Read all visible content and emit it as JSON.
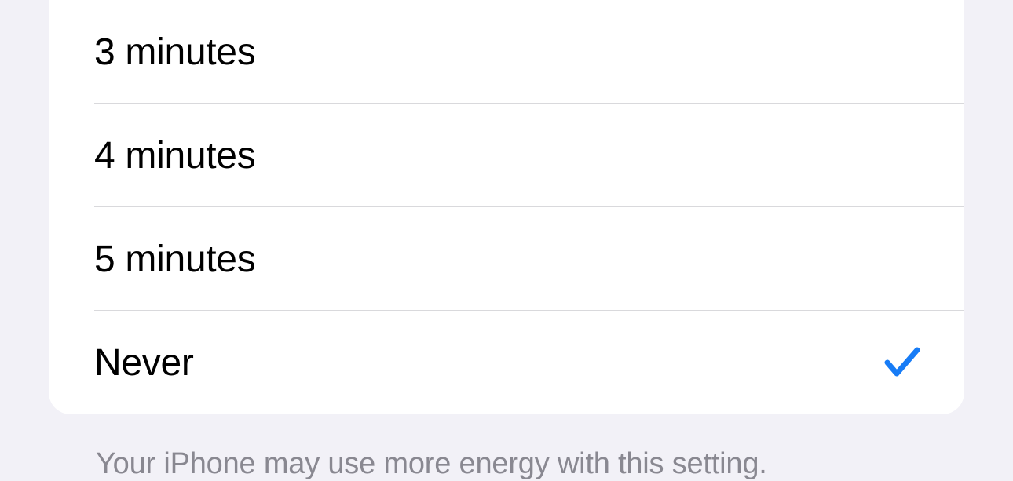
{
  "options": [
    {
      "label": "3 minutes",
      "selected": false
    },
    {
      "label": "4 minutes",
      "selected": false
    },
    {
      "label": "5 minutes",
      "selected": false
    },
    {
      "label": "Never",
      "selected": true
    }
  ],
  "footer": "Your iPhone may use more energy with this setting.",
  "accent_color": "#177cf6"
}
